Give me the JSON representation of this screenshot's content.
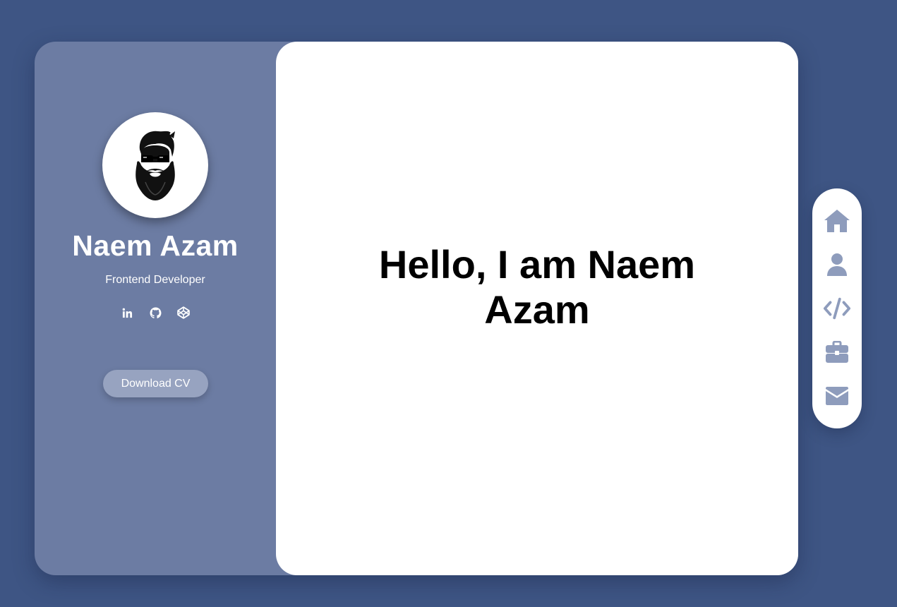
{
  "profile": {
    "name": "Naem Azam",
    "role": "Frontend Developer",
    "download_label": "Download CV",
    "socials": [
      "linkedin-icon",
      "github-icon",
      "codepen-icon"
    ]
  },
  "content": {
    "heading": "Hello, I am Naem Azam"
  },
  "nav": {
    "items": [
      "home-icon",
      "user-icon",
      "code-icon",
      "briefcase-icon",
      "envelope-icon"
    ]
  },
  "colors": {
    "background": "#3e5584",
    "sidebar": "#6c7ca3",
    "button": "#97a3c0",
    "nav_icon": "#8e9cbc"
  }
}
